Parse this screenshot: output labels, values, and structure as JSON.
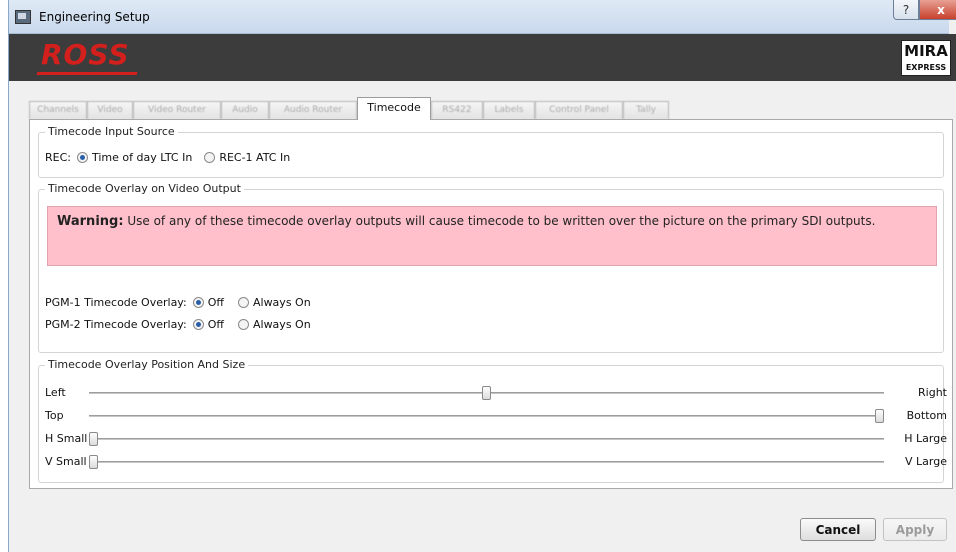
{
  "window": {
    "title": "Engineering Setup"
  },
  "titlebar": {
    "help_label": "?",
    "close_label": "x"
  },
  "banner": {
    "logo_text": "ROSS",
    "product_name": "MIRA",
    "product_edition": "EXPRESS"
  },
  "tabs": [
    {
      "label": "Channels",
      "active": false
    },
    {
      "label": "Video",
      "active": false
    },
    {
      "label": "Video Router",
      "active": false
    },
    {
      "label": "Audio",
      "active": false
    },
    {
      "label": "Audio Router",
      "active": false
    },
    {
      "label": "Timecode",
      "active": true
    },
    {
      "label": "RS422",
      "active": false
    },
    {
      "label": "Labels",
      "active": false
    },
    {
      "label": "Control Panel",
      "active": false
    },
    {
      "label": "Tally",
      "active": false
    }
  ],
  "input_source": {
    "group_title": "Timecode Input Source",
    "rec_label": "REC:",
    "option1": "Time of day LTC In",
    "option2": "REC-1 ATC In",
    "selected": "Time of day LTC In"
  },
  "overlay": {
    "group_title": "Timecode Overlay on Video Output",
    "warning_bold": "Warning:",
    "warning_text": "Use of any of these timecode overlay outputs will cause timecode to be written over the picture on the primary SDI outputs.",
    "pgm1_label": "PGM-1 Timecode Overlay:",
    "pgm2_label": "PGM-2 Timecode Overlay:",
    "off_label": "Off",
    "on_label": "Always On",
    "pgm1_selected": "Off",
    "pgm2_selected": "Off"
  },
  "position": {
    "group_title": "Timecode Overlay Position And Size",
    "sliders": [
      {
        "left": "Left",
        "right": "Right",
        "value": 0.5
      },
      {
        "left": "Top",
        "right": "Bottom",
        "value": 1.0
      },
      {
        "left": "H Small",
        "right": "H Large",
        "value": 0.0
      },
      {
        "left": "V Small",
        "right": "V Large",
        "value": 0.0
      }
    ]
  },
  "footer": {
    "cancel_label": "Cancel",
    "apply_label": "Apply"
  },
  "colors": {
    "warning_bg": "#ffc0cb",
    "brand_red": "#d3201d",
    "radio_dot": "#2a5fa8"
  }
}
